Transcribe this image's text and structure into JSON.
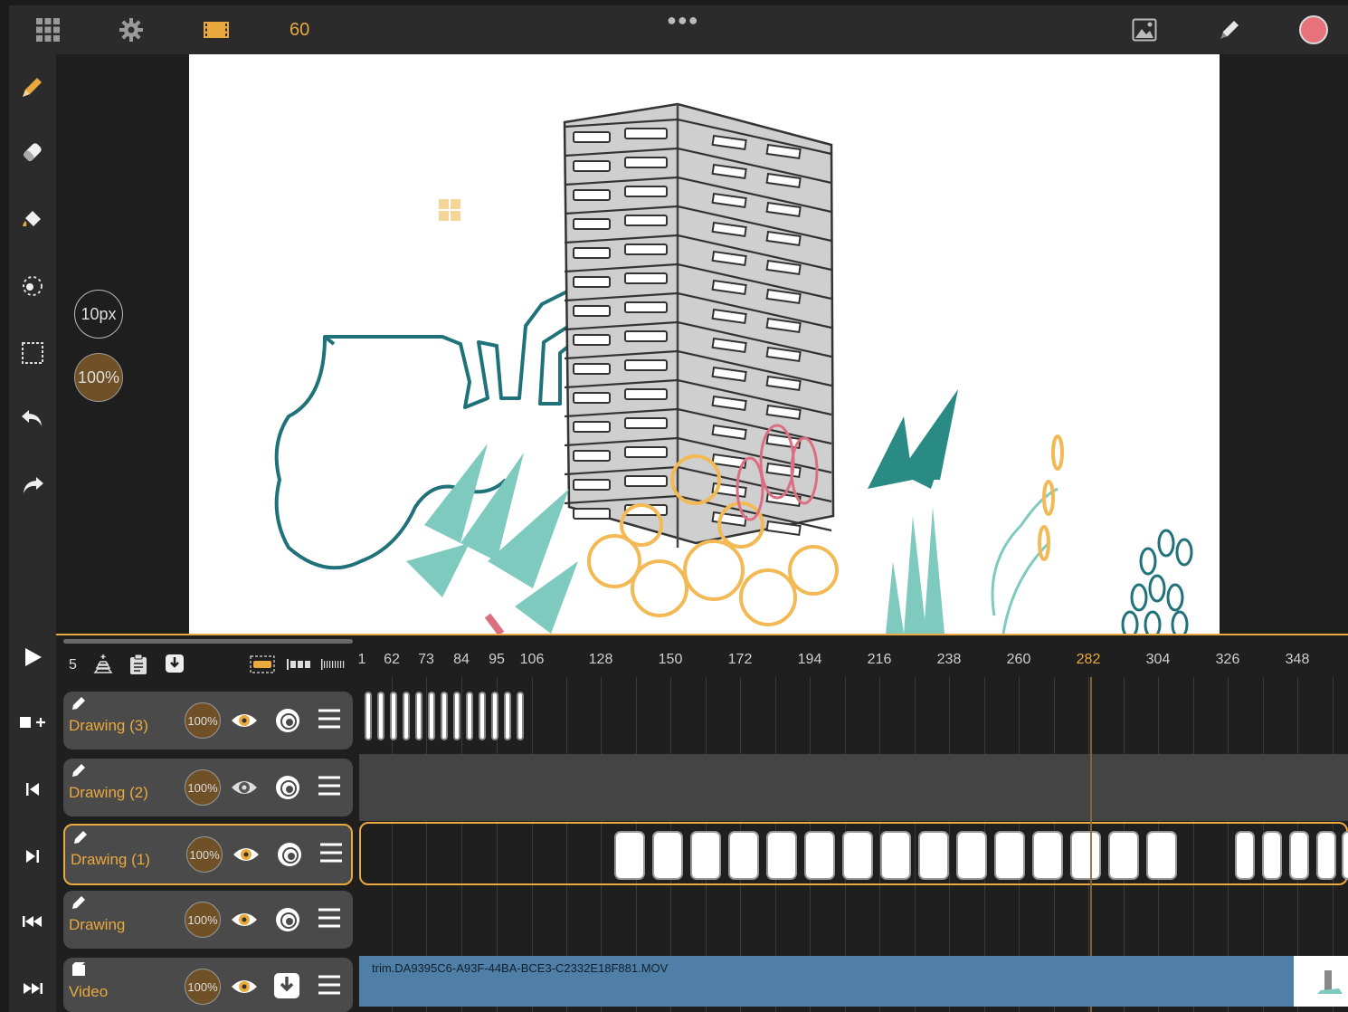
{
  "topbar": {
    "fps": "60"
  },
  "brush": {
    "size": "10px",
    "opacity": "100%"
  },
  "timeline": {
    "frame_count": "5",
    "ruler": [
      "1",
      "62",
      "73",
      "84",
      "95",
      "106",
      "128",
      "150",
      "172",
      "194",
      "216",
      "238",
      "260",
      "282",
      "304",
      "326",
      "348"
    ],
    "current_frame": "282",
    "layers": [
      {
        "name": "Drawing (3)",
        "opacity": "100%"
      },
      {
        "name": "Drawing (2)",
        "opacity": "100%"
      },
      {
        "name": "Drawing (1)",
        "opacity": "100%"
      },
      {
        "name": "Drawing",
        "opacity": "100%"
      },
      {
        "name": "Video",
        "opacity": "100%"
      }
    ],
    "video_file": "trim.DA9395C6-A93F-44BA-BCE3-C2332E18F881.MOV"
  },
  "colors": {
    "accent": "#e9a93e",
    "record": "#e8727a",
    "video_track": "#4f7fa6"
  }
}
